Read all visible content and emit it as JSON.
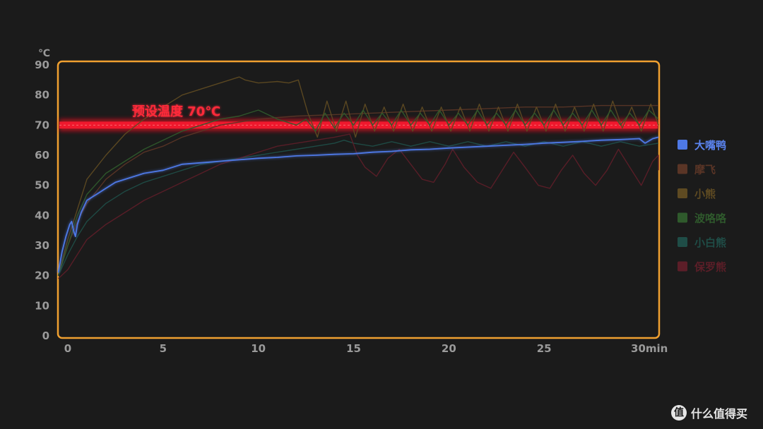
{
  "chart_data": {
    "type": "line",
    "title": "",
    "xlabel": "",
    "ylabel": "",
    "x_unit": "min",
    "y_unit": "℃",
    "xlim": [
      -0.5,
      31
    ],
    "ylim": [
      0,
      90
    ],
    "x_ticks": [
      0,
      5,
      10,
      15,
      20,
      25,
      30
    ],
    "x_tick_labels": [
      "0",
      "5",
      "10",
      "15",
      "20",
      "25",
      "30min"
    ],
    "y_ticks": [
      0,
      10,
      20,
      30,
      40,
      50,
      60,
      70,
      80,
      90
    ],
    "grid": false,
    "legend_position": "right",
    "annotation": {
      "text": "预设温度 70℃",
      "y": 70
    },
    "series": [
      {
        "name": "大嘴鸭",
        "color": "#4e79e6",
        "highlight": true,
        "points": [
          [
            -0.5,
            21
          ],
          [
            -0.3,
            28
          ],
          [
            -0.1,
            33
          ],
          [
            0.1,
            37
          ],
          [
            0.2,
            38
          ],
          [
            0.3,
            35
          ],
          [
            0.4,
            33
          ],
          [
            0.5,
            37
          ],
          [
            0.7,
            41
          ],
          [
            1,
            45
          ],
          [
            1.5,
            47
          ],
          [
            2,
            49
          ],
          [
            2.5,
            51
          ],
          [
            3,
            52
          ],
          [
            4,
            54
          ],
          [
            5,
            55
          ],
          [
            6,
            57
          ],
          [
            7,
            57.5
          ],
          [
            8,
            58
          ],
          [
            9,
            58.5
          ],
          [
            10,
            59
          ],
          [
            11,
            59.3
          ],
          [
            12,
            59.8
          ],
          [
            13,
            60
          ],
          [
            14,
            60.3
          ],
          [
            15,
            60.5
          ],
          [
            16,
            61
          ],
          [
            17,
            61.3
          ],
          [
            18,
            61.8
          ],
          [
            19,
            62
          ],
          [
            20,
            62.4
          ],
          [
            21,
            62.7
          ],
          [
            22,
            63
          ],
          [
            23,
            63.3
          ],
          [
            24,
            63.6
          ],
          [
            25,
            64
          ],
          [
            26,
            64.3
          ],
          [
            27,
            64.6
          ],
          [
            28,
            65
          ],
          [
            29,
            65.2
          ],
          [
            30,
            65.5
          ],
          [
            30.3,
            64
          ],
          [
            30.7,
            65.5
          ],
          [
            31,
            66
          ]
        ]
      },
      {
        "name": "摩飞",
        "color": "#5a3526",
        "highlight": false,
        "points": [
          [
            -0.5,
            20
          ],
          [
            0,
            30
          ],
          [
            0.5,
            38
          ],
          [
            1,
            44
          ],
          [
            2,
            52
          ],
          [
            3,
            57
          ],
          [
            4,
            61
          ],
          [
            5,
            63
          ],
          [
            6,
            66
          ],
          [
            7,
            68
          ],
          [
            8,
            70
          ],
          [
            9,
            71
          ],
          [
            10,
            72
          ],
          [
            12,
            73
          ],
          [
            14,
            73.5
          ],
          [
            16,
            74
          ],
          [
            18,
            74.5
          ],
          [
            20,
            75
          ],
          [
            22,
            75.5
          ],
          [
            24,
            76
          ],
          [
            26,
            76
          ],
          [
            28,
            76.5
          ],
          [
            30,
            76.5
          ],
          [
            31,
            76.5
          ]
        ]
      },
      {
        "name": "小熊",
        "color": "#5e4a22",
        "highlight": false,
        "points": [
          [
            -0.5,
            20
          ],
          [
            0,
            32
          ],
          [
            0.5,
            42
          ],
          [
            1,
            52
          ],
          [
            2,
            60
          ],
          [
            3,
            67
          ],
          [
            4,
            72
          ],
          [
            5,
            76
          ],
          [
            6,
            80
          ],
          [
            7,
            82
          ],
          [
            8,
            84
          ],
          [
            9,
            86
          ],
          [
            9.3,
            85
          ],
          [
            10,
            84
          ],
          [
            11,
            84.5
          ],
          [
            11.6,
            84
          ],
          [
            12.1,
            85
          ],
          [
            12.6,
            74
          ],
          [
            13.1,
            66
          ],
          [
            13.6,
            78
          ],
          [
            14.1,
            68
          ],
          [
            14.6,
            78
          ],
          [
            15.1,
            66
          ],
          [
            15.6,
            77
          ],
          [
            16.1,
            68
          ],
          [
            16.6,
            76
          ],
          [
            17.1,
            68
          ],
          [
            17.6,
            77
          ],
          [
            18.1,
            68
          ],
          [
            18.6,
            76
          ],
          [
            19.1,
            68
          ],
          [
            19.6,
            76
          ],
          [
            20.1,
            68
          ],
          [
            20.6,
            76
          ],
          [
            21.1,
            68
          ],
          [
            21.6,
            77
          ],
          [
            22.1,
            68
          ],
          [
            22.6,
            76
          ],
          [
            23.1,
            68
          ],
          [
            23.6,
            77
          ],
          [
            24.1,
            68
          ],
          [
            24.6,
            76
          ],
          [
            25.1,
            68
          ],
          [
            25.6,
            77
          ],
          [
            26.1,
            68
          ],
          [
            26.6,
            76
          ],
          [
            27.1,
            68
          ],
          [
            27.6,
            77
          ],
          [
            28.1,
            68
          ],
          [
            28.6,
            78
          ],
          [
            29.1,
            69
          ],
          [
            29.6,
            76
          ],
          [
            30.1,
            68
          ],
          [
            30.6,
            77
          ],
          [
            31,
            70
          ]
        ]
      },
      {
        "name": "波咯咯",
        "color": "#2f5a2c",
        "highlight": false,
        "points": [
          [
            -0.5,
            20
          ],
          [
            0,
            30
          ],
          [
            0.5,
            40
          ],
          [
            1,
            47
          ],
          [
            2,
            54
          ],
          [
            3,
            58
          ],
          [
            4,
            62
          ],
          [
            5,
            65
          ],
          [
            6,
            68
          ],
          [
            7,
            70
          ],
          [
            8,
            72
          ],
          [
            9,
            73
          ],
          [
            10,
            75
          ],
          [
            11,
            72
          ],
          [
            12,
            70
          ],
          [
            12.5,
            72
          ],
          [
            13,
            68
          ],
          [
            13.5,
            74
          ],
          [
            14,
            69
          ],
          [
            14.5,
            74
          ],
          [
            15,
            70
          ],
          [
            15.5,
            75
          ],
          [
            16,
            70
          ],
          [
            16.5,
            74
          ],
          [
            17,
            70
          ],
          [
            17.5,
            75
          ],
          [
            18,
            70
          ],
          [
            18.5,
            74
          ],
          [
            19,
            70
          ],
          [
            19.5,
            75
          ],
          [
            20,
            70
          ],
          [
            20.5,
            74
          ],
          [
            21,
            70
          ],
          [
            21.5,
            75
          ],
          [
            22,
            70
          ],
          [
            22.5,
            74
          ],
          [
            23,
            70
          ],
          [
            23.5,
            75
          ],
          [
            24,
            70
          ],
          [
            24.5,
            74
          ],
          [
            25,
            70
          ],
          [
            25.5,
            75
          ],
          [
            26,
            70
          ],
          [
            26.5,
            74
          ],
          [
            27,
            70
          ],
          [
            27.5,
            75
          ],
          [
            28,
            70
          ],
          [
            28.5,
            75
          ],
          [
            29,
            70
          ],
          [
            29.5,
            74
          ],
          [
            30,
            70
          ],
          [
            30.5,
            75
          ],
          [
            31,
            72
          ]
        ]
      },
      {
        "name": "小白熊",
        "color": "#1f4d47",
        "highlight": false,
        "points": [
          [
            -0.5,
            20
          ],
          [
            0,
            27
          ],
          [
            0.5,
            33
          ],
          [
            1,
            38
          ],
          [
            2,
            44
          ],
          [
            3,
            48
          ],
          [
            4,
            51
          ],
          [
            5,
            53
          ],
          [
            6,
            55
          ],
          [
            7,
            57
          ],
          [
            8,
            58
          ],
          [
            9,
            59
          ],
          [
            10,
            60
          ],
          [
            11,
            61
          ],
          [
            12,
            62
          ],
          [
            13,
            63
          ],
          [
            14,
            64
          ],
          [
            14.5,
            65
          ],
          [
            15,
            64
          ],
          [
            16,
            63
          ],
          [
            17,
            64.5
          ],
          [
            18,
            63
          ],
          [
            19,
            64.5
          ],
          [
            20,
            63
          ],
          [
            21,
            64.5
          ],
          [
            22,
            63
          ],
          [
            23,
            64.5
          ],
          [
            24,
            63
          ],
          [
            25,
            64.5
          ],
          [
            26,
            63
          ],
          [
            27,
            64.5
          ],
          [
            28,
            63
          ],
          [
            29,
            64.5
          ],
          [
            30,
            63
          ],
          [
            31,
            64
          ]
        ]
      },
      {
        "name": "保罗熊",
        "color": "#5c1e28",
        "highlight": false,
        "points": [
          [
            -0.5,
            19
          ],
          [
            0,
            22
          ],
          [
            0.5,
            27
          ],
          [
            1,
            32
          ],
          [
            2,
            37
          ],
          [
            3,
            41
          ],
          [
            4,
            45
          ],
          [
            5,
            48
          ],
          [
            6,
            51
          ],
          [
            7,
            54
          ],
          [
            8,
            57
          ],
          [
            9,
            59
          ],
          [
            10,
            61
          ],
          [
            11,
            63
          ],
          [
            12,
            64
          ],
          [
            13,
            65
          ],
          [
            14,
            66
          ],
          [
            14.8,
            67
          ],
          [
            15.2,
            60
          ],
          [
            15.6,
            56
          ],
          [
            16.2,
            53
          ],
          [
            16.8,
            59
          ],
          [
            17.4,
            62
          ],
          [
            18,
            57
          ],
          [
            18.6,
            52
          ],
          [
            19.2,
            51
          ],
          [
            19.8,
            57
          ],
          [
            20.2,
            62
          ],
          [
            20.8,
            56
          ],
          [
            21.5,
            51
          ],
          [
            22.2,
            49
          ],
          [
            22.8,
            55
          ],
          [
            23.4,
            61
          ],
          [
            24,
            56
          ],
          [
            24.7,
            50
          ],
          [
            25.3,
            49
          ],
          [
            25.9,
            55
          ],
          [
            26.5,
            60
          ],
          [
            27.1,
            54
          ],
          [
            27.7,
            50
          ],
          [
            28.3,
            55
          ],
          [
            28.9,
            62
          ],
          [
            29.5,
            56
          ],
          [
            30.1,
            50
          ],
          [
            30.7,
            58
          ],
          [
            31,
            60
          ],
          [
            31,
            55
          ]
        ]
      }
    ]
  },
  "watermark": {
    "logo": "值",
    "text": "什么值得买"
  }
}
